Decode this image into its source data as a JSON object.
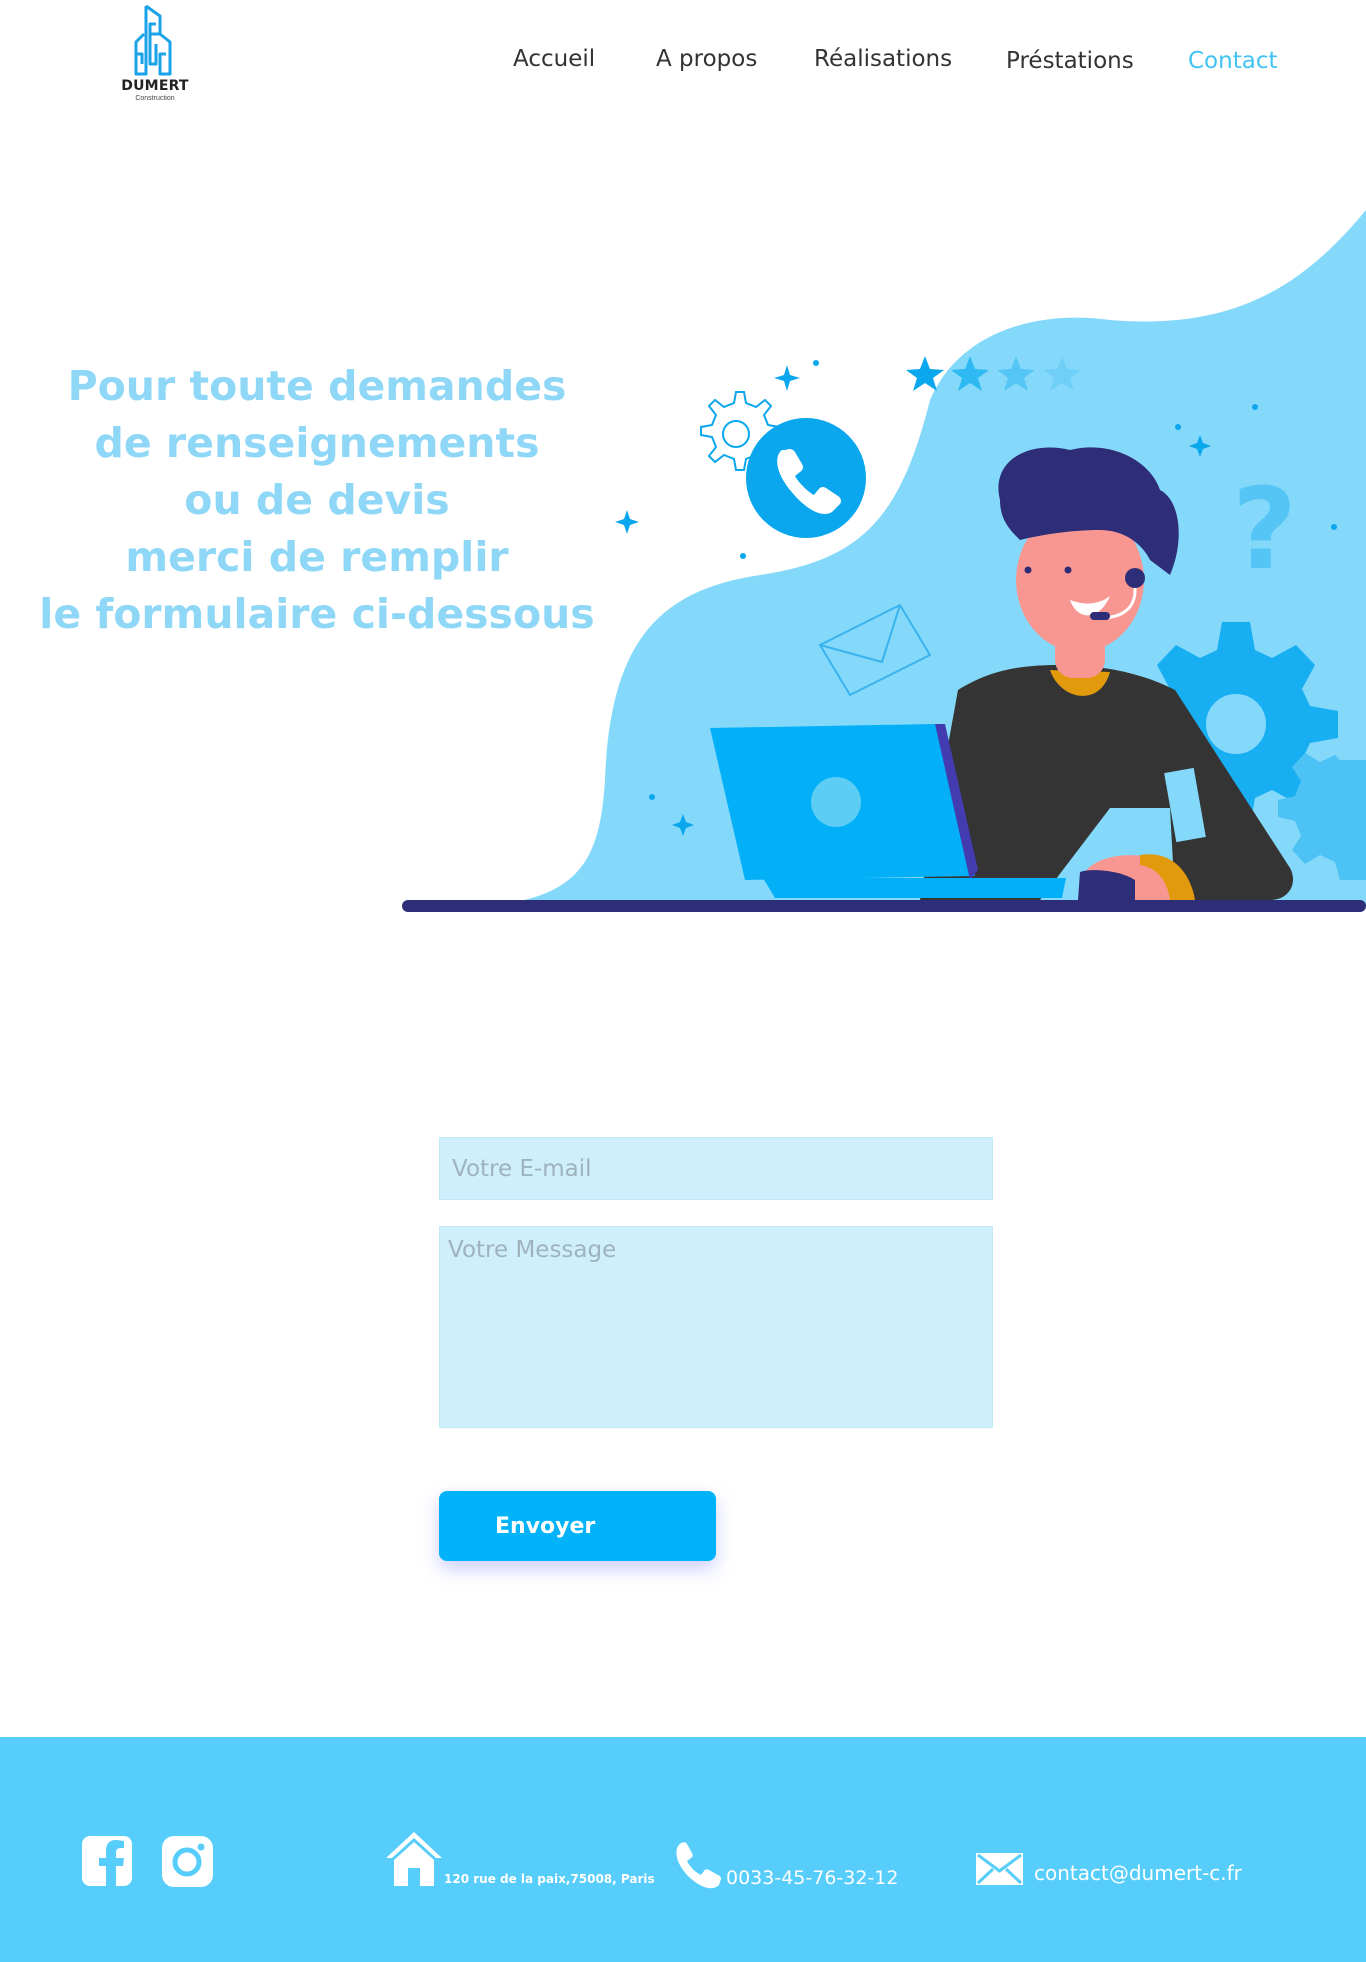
{
  "brand": {
    "name": "DUMERT",
    "tagline": "Construction",
    "accent_color": "#41c3f3",
    "primary_color": "#02b3f9",
    "footer_color": "#56cdfb"
  },
  "nav": {
    "items": [
      {
        "label": "Accueil",
        "active": false
      },
      {
        "label": "A propos",
        "active": false
      },
      {
        "label": "Réalisations",
        "active": false
      },
      {
        "label": "Préstations",
        "active": false
      },
      {
        "label": "Contact",
        "active": true
      }
    ]
  },
  "hero": {
    "lines": [
      "Pour toute demandes",
      "de renseignements",
      "ou de devis",
      "merci de remplir",
      "le formulaire ci-dessous"
    ],
    "illustration": "customer-support-illustration"
  },
  "form": {
    "email_placeholder": "Votre E-mail",
    "message_placeholder": "Votre Message",
    "submit_label": "Envoyer"
  },
  "footer": {
    "social": [
      {
        "icon": "facebook-icon"
      },
      {
        "icon": "instagram-icon"
      }
    ],
    "address": "120 rue de la paix,75008, Paris",
    "phone": "0033-45-76-32-12",
    "email": "contact@dumert-c.fr"
  }
}
